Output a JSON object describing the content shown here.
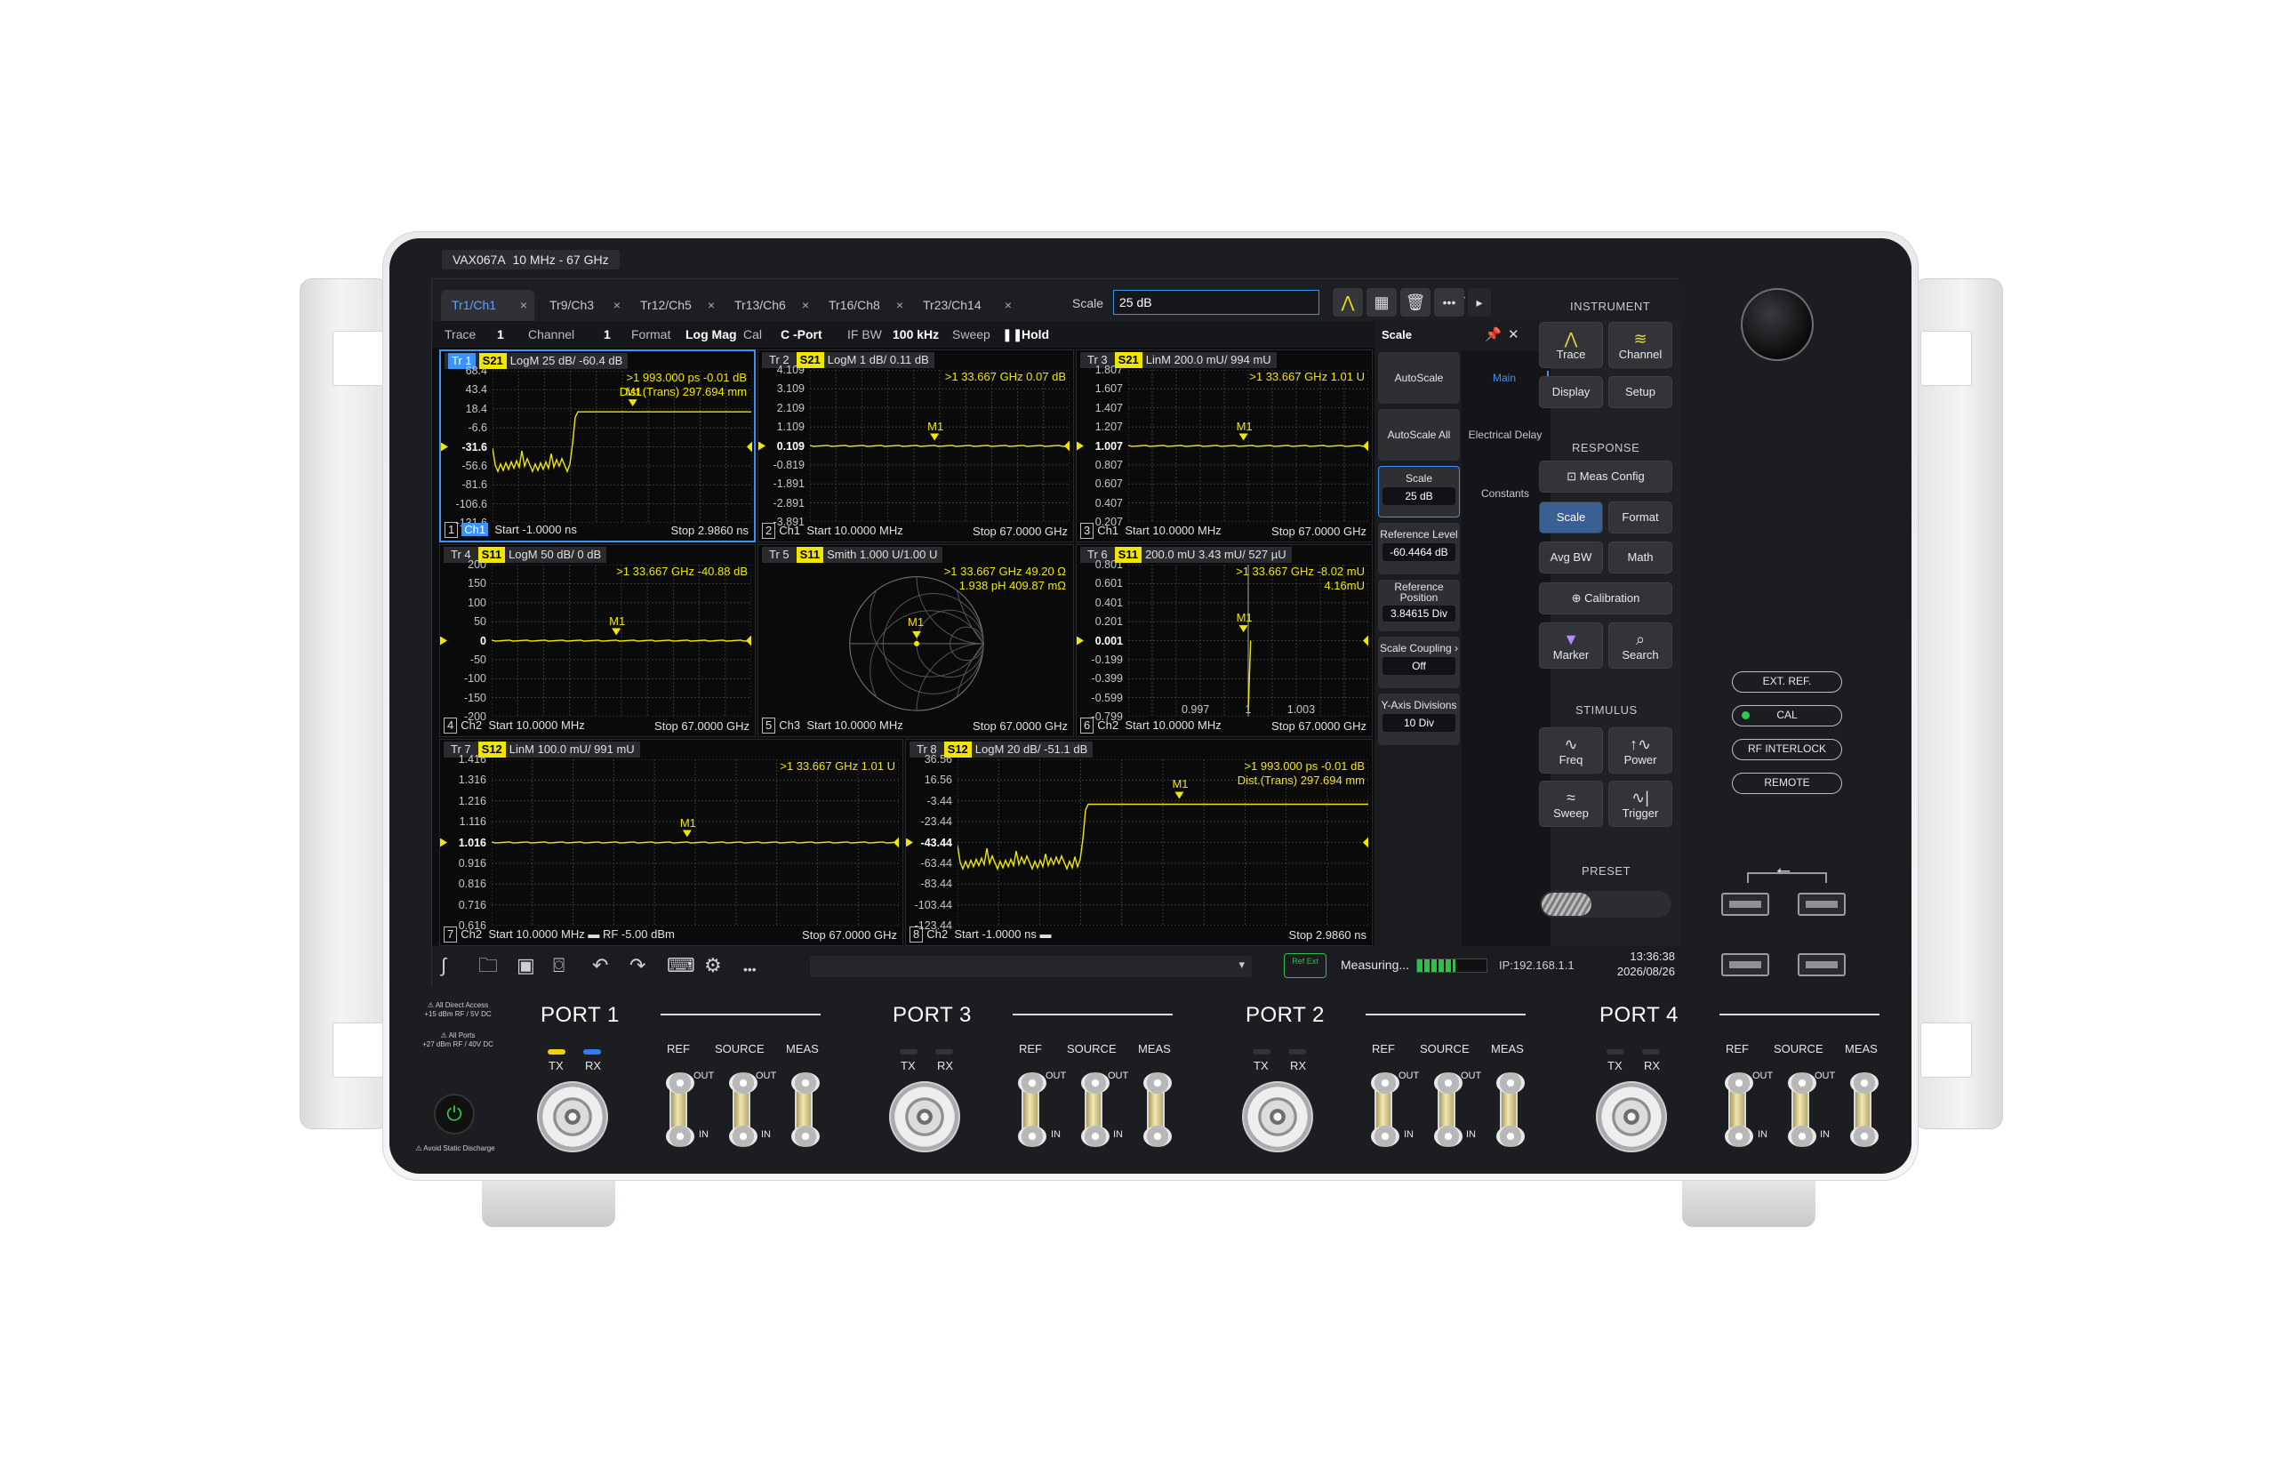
{
  "model_label": "VAX067A",
  "freq_range": "10 MHz - 67 GHz",
  "tabs": [
    {
      "label": "Tr1/Ch1",
      "active": true
    },
    {
      "label": "Tr9/Ch3",
      "active": false
    },
    {
      "label": "Tr12/Ch5",
      "active": false
    },
    {
      "label": "Tr13/Ch6",
      "active": false
    },
    {
      "label": "Tr16/Ch8",
      "active": false
    },
    {
      "label": "Tr23/Ch14",
      "active": false
    }
  ],
  "tab_close": "×",
  "add_tab": "+",
  "toolbar": {
    "scale_label": "Scale",
    "scale_value": "25 dB",
    "more": "•••",
    "next": "▸"
  },
  "status": {
    "trace_label": "Trace",
    "trace_value": "1",
    "channel_label": "Channel",
    "channel_value": "1",
    "format_label": "Format",
    "format_value": "Log Mag",
    "cal_label": "Cal",
    "cal_value": "C -Port",
    "ifbw_label": "IF BW",
    "ifbw_value": "100 kHz",
    "sweep_label": "Sweep",
    "sweep_value": "Hold",
    "pause_icon": "❚❚"
  },
  "traces": [
    {
      "id": "1",
      "param": "S21",
      "hdr": "LogM 25 dB/ -60.4 dB",
      "ylabels": [
        "68.4",
        "43.4",
        "18.4",
        "-6.6",
        "-31.6",
        "-56.6",
        "-81.6",
        "-106.6",
        "-131.6"
      ],
      "ref": "-31.6",
      "mline": ">1   993.000 ps   -0.01 dB",
      "mline2": "Dist.(Trans)   297.694 mm",
      "marker": "M1",
      "num": "1",
      "ch": "Ch1",
      "start": "Start  -1.0000 ns",
      "stop": "Stop  2.9860 ns",
      "kind": "step"
    },
    {
      "id": "2",
      "param": "S21",
      "hdr": "LogM 1 dB/ 0.11 dB",
      "ylabels": [
        "4.109",
        "3.109",
        "2.109",
        "1.109",
        "0.109",
        "-0.819",
        "-1.891",
        "-2.891",
        "-3.891"
      ],
      "ref": "0.109",
      "mline": ">1    33.667 GHz   0.07 dB",
      "mline2": "",
      "marker": "M1",
      "num": "2",
      "ch": "Ch1",
      "start": "Start 10.0000 MHz",
      "stop": "Stop  67.0000 GHz",
      "kind": "flat"
    },
    {
      "id": "3",
      "param": "S21",
      "hdr": "LinM 200.0 mU/ 994 mU",
      "ylabels": [
        "1.807",
        "1.607",
        "1.407",
        "1.207",
        "1.007",
        "0.807",
        "0.607",
        "0.407",
        "0.207"
      ],
      "ref": "1.007",
      "mline": ">1    33.667 GHz    1.01 U",
      "mline2": "",
      "marker": "M1",
      "num": "3",
      "ch": "Ch1",
      "start": "Start 10.0000 MHz",
      "stop": "Stop  67.0000 GHz",
      "kind": "flat"
    },
    {
      "id": "4",
      "param": "S11",
      "hdr": "LogM 50 dB/ 0 dB",
      "ylabels": [
        "200",
        "150",
        "100",
        "50",
        "0",
        "-50",
        "-100",
        "-150",
        "-200"
      ],
      "ref": "0",
      "mline": ">1    33.667 GHz  -40.88 dB",
      "mline2": "",
      "marker": "M1",
      "num": "4",
      "ch": "Ch2",
      "start": "Start 10.0000 MHz",
      "stop": "Stop  67.0000 GHz",
      "kind": "flat"
    },
    {
      "id": "5",
      "param": "S11",
      "hdr": "Smith 1.000 U/1.00 U",
      "ylabels": [],
      "ref": "",
      "mline": ">1   33.667 GHz       49.20 Ω",
      "mline2": "1.938 pH     409.87 mΩ",
      "marker": "M1",
      "num": "5",
      "ch": "Ch3",
      "start": "Start 10.0000 MHz",
      "stop": "Stop  67.0000 GHz",
      "kind": "smith"
    },
    {
      "id": "6",
      "param": "S11",
      "hdr": "200.0 mU 3.43 mU/ 527 µU",
      "ylabels": [
        "0.801",
        "0.601",
        "0.401",
        "0.201",
        "0.001",
        "-0.199",
        "-0.399",
        "-0.599",
        "-0.799"
      ],
      "ref": "0.001",
      "mline": ">1    33.667 GHz    -8.02 mU",
      "mline2": "4.16mU",
      "marker": "M1",
      "num": "6",
      "ch": "Ch2",
      "start": "Start 10.0000 MHz",
      "stop": "Stop  67.0000 GHz",
      "kind": "polar",
      "xl": [
        "0.997",
        "1",
        "1.003"
      ]
    },
    {
      "id": "7",
      "param": "S12",
      "hdr": "LinM 100.0 mU/ 991 mU",
      "ylabels": [
        "1.416",
        "1.316",
        "1.216",
        "1.116",
        "1.016",
        "0.916",
        "0.816",
        "0.716",
        "0.616"
      ],
      "ref": "1.016",
      "mline": ">1    33.667 GHz    1.01 U",
      "mline2": "",
      "marker": "M1",
      "num": "7",
      "ch": "Ch2",
      "start": "Start 10.0000 MHz  ▬       RF  -5.00 dBm",
      "stop": "Stop  67.0000 GHz",
      "kind": "flat"
    },
    {
      "id": "8",
      "param": "S12",
      "hdr": "LogM 20 dB/ -51.1 dB",
      "ylabels": [
        "36.56",
        "16.56",
        "-3.44",
        "-23.44",
        "-43.44",
        "-63.44",
        "-83.44",
        "-103.44",
        "-123.44"
      ],
      "ref": "-43.44",
      "mline": ">1    993.000 ps   -0.01 dB",
      "mline2": "Dist.(Trans)    297.694 mm",
      "marker": "M1",
      "num": "8",
      "ch": "Ch2",
      "start": "Start  -1.0000 ns  ▬",
      "stop": "Stop  2.9860 ns",
      "kind": "step"
    }
  ],
  "tr_prefix": "Tr",
  "scale_panel": {
    "title": "Scale",
    "pin_icon": "pin-icon",
    "close": "✕",
    "autoscale": "AutoScale",
    "autoscale_all": "AutoScale All",
    "scale_label": "Scale",
    "scale_value": "25 dB",
    "ref_level_label": "Reference Level",
    "ref_level_value": "-60.4464 dB",
    "ref_pos_label": "Reference Position",
    "ref_pos_value": "3.84615 Div",
    "coupling_label": "Scale Coupling",
    "coupling_value": "Off",
    "ydiv_label": "Y-Axis Divisions",
    "ydiv_value": "10 Div",
    "tabs": [
      "Main",
      "Electrical Delay",
      "Constants"
    ]
  },
  "hardkeys": {
    "instrument": "INSTRUMENT",
    "trace": "Trace",
    "channel": "Channel",
    "display": "Display",
    "setup": "Setup",
    "response": "RESPONSE",
    "meas_config": "Meas Config",
    "scale": "Scale",
    "format": "Format",
    "avg_bw": "Avg BW",
    "math": "Math",
    "calibration": "Calibration",
    "marker": "Marker",
    "search": "Search",
    "stimulus": "STIMULUS",
    "freq": "Freq",
    "power": "Power",
    "sweep": "Sweep",
    "trigger": "Trigger",
    "preset": "PRESET"
  },
  "bottom_bar": {
    "measuring": "Measuring...",
    "ip": "IP:192.168.1.1",
    "time": "13:36:38",
    "date": "2026/08/26",
    "ref_ext": "Ref Ext",
    "more": "•••",
    "dropdown": "▾"
  },
  "front": {
    "ext_ref": "EXT. REF.",
    "cal": "CAL",
    "rf_interlock": "RF INTERLOCK",
    "remote": "REMOTE",
    "warn1": "All Direct Access",
    "warn1b": "+15 dBm RF / 5V DC",
    "warn2": "All Ports",
    "warn2b": "+27 dBm RF / 40V DC",
    "static": "Avoid Static Discharge",
    "ports": [
      "PORT 1",
      "PORT 3",
      "PORT 2",
      "PORT 4"
    ],
    "tx": "TX",
    "rx": "RX",
    "ref": "REF",
    "source": "SOURCE",
    "meas": "MEAS",
    "out": "OUT",
    "in": "IN"
  },
  "colors": {
    "trace": "#f2e600",
    "accent": "#3c93f5",
    "screen_bg": "#0a0a0b",
    "panel": "#1c1d20"
  }
}
